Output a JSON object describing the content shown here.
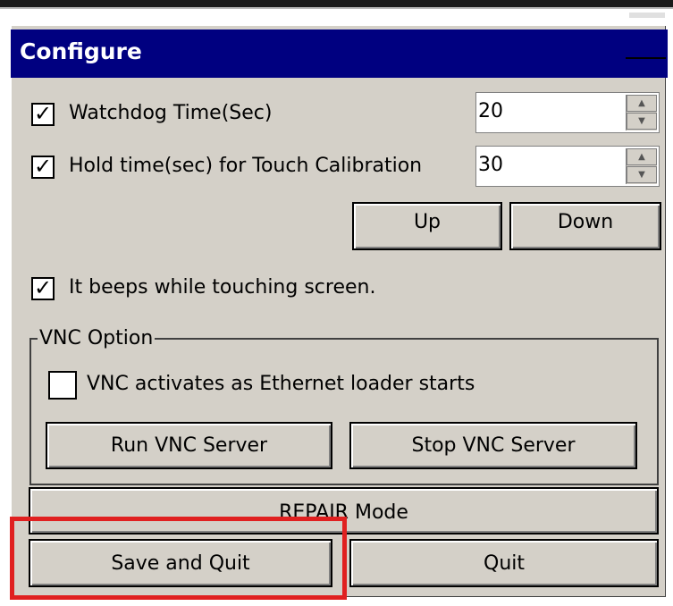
{
  "window": {
    "title": "Configure"
  },
  "watchdog": {
    "checked": true,
    "label": "Watchdog Time(Sec)",
    "value": "20"
  },
  "hold_time": {
    "checked": true,
    "label": "Hold time(sec) for Touch Calibration",
    "value": "30"
  },
  "spin_buttons": {
    "up": "Up",
    "down": "Down"
  },
  "beep": {
    "checked": true,
    "label": "It beeps while touching screen."
  },
  "vnc": {
    "legend": "VNC Option",
    "activate": {
      "checked": false,
      "label": "VNC activates as Ethernet loader starts"
    },
    "run_label": "Run VNC Server",
    "stop_label": "Stop VNC Server"
  },
  "repair_label": "REPAIR Mode",
  "save_quit_label": "Save and Quit",
  "quit_label": "Quit",
  "checkmark": "✓",
  "highlight_color": "#e02020",
  "titlebar_color": "#000080"
}
